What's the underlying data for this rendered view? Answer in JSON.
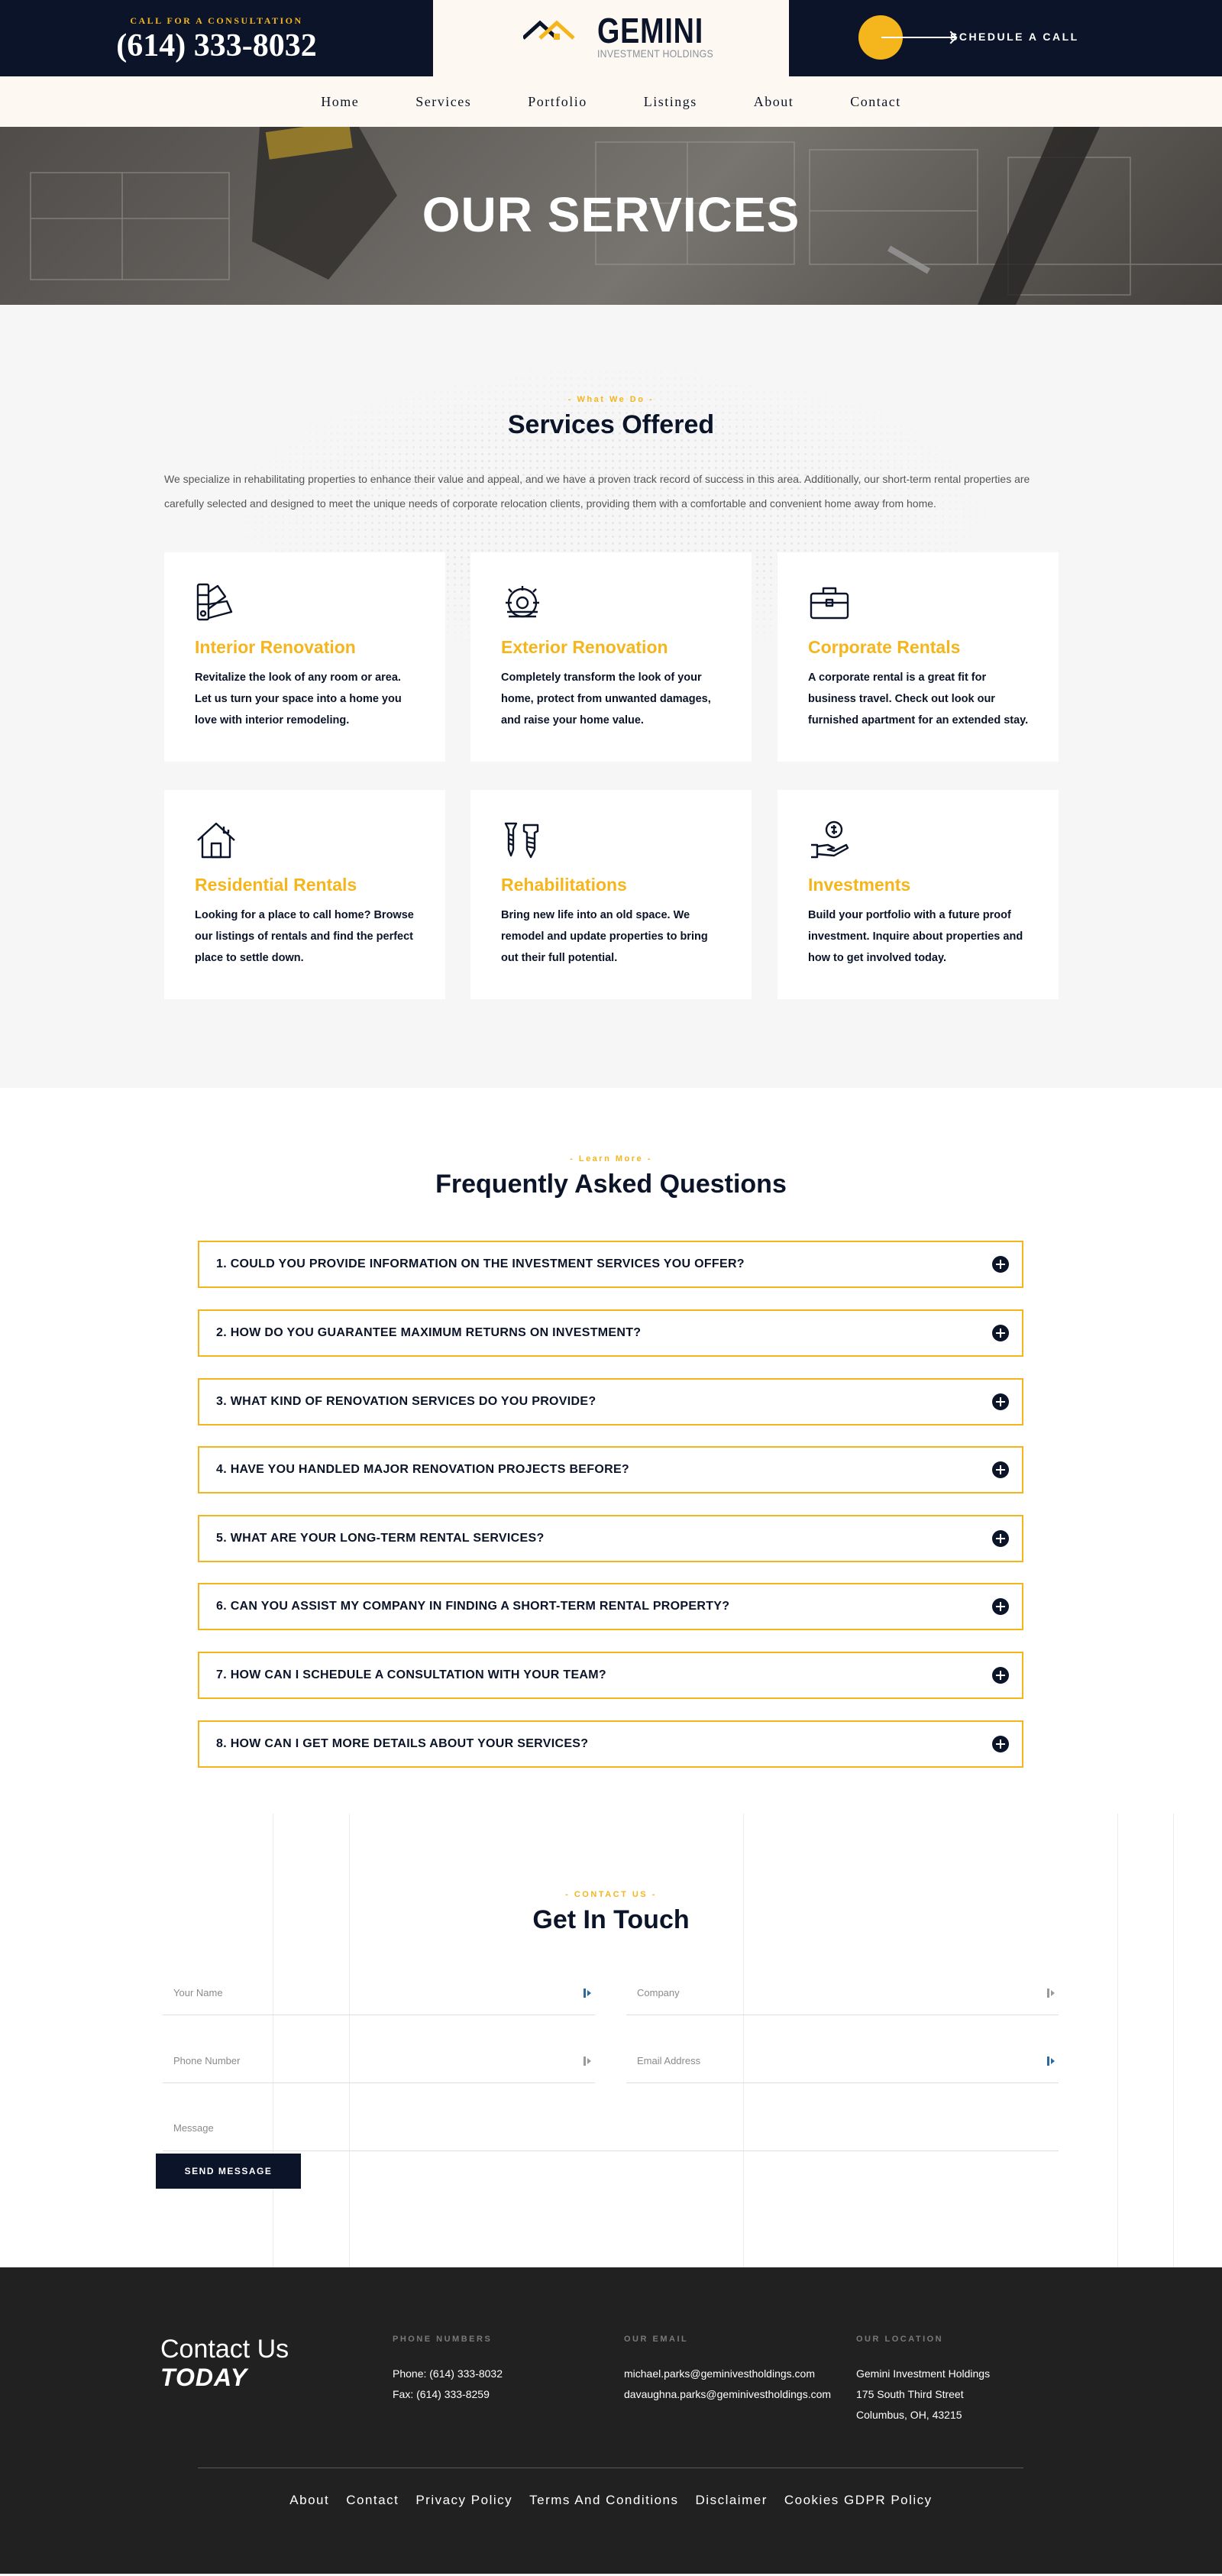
{
  "header": {
    "call_label": "CALL FOR A CONSULTATION",
    "phone": "(614) 333-8032",
    "logo_title": "GEMINI",
    "logo_subtitle": "INVESTMENT HOLDINGS",
    "schedule_label": "SCHEDULE A CALL"
  },
  "nav": {
    "items": [
      "Home",
      "Services",
      "Portfolio",
      "Listings",
      "About",
      "Contact"
    ]
  },
  "hero": {
    "title": "OUR SERVICES"
  },
  "services": {
    "eyebrow": "- What We Do -",
    "title": "Services Offered",
    "intro": "We specialize in rehabilitating properties to enhance their value and appeal, and we have a proven track record of success in this area. Additionally, our short-term rental properties are carefully selected and designed to meet the unique needs of corporate relocation clients, providing them with a comfortable and convenient home away from home.",
    "cards": [
      {
        "icon": "color-swatch-icon",
        "title": "Interior Renovation",
        "text": "Revitalize the look of any room or area. Let us turn your space into a home you love with interior remodeling."
      },
      {
        "icon": "circular-saw-icon",
        "title": "Exterior Renovation",
        "text": "Completely transform the look of your home, protect from unwanted damages, and raise your home value."
      },
      {
        "icon": "briefcase-icon",
        "title": "Corporate Rentals",
        "text": "A corporate rental is a great fit for business travel. Check out look our furnished apartment for an extended stay."
      },
      {
        "icon": "house-icon",
        "title": "Residential Rentals",
        "text": "Looking for a place to call home? Browse our listings of rentals and find the perfect place to settle down."
      },
      {
        "icon": "screw-tools-icon",
        "title": "Rehabilitations",
        "text": "Bring new life into an old space. We remodel and update properties to bring out their full potential."
      },
      {
        "icon": "hand-dollar-icon",
        "title": "Investments",
        "text": "Build your portfolio with a future proof investment. Inquire about properties and how to get involved today."
      }
    ]
  },
  "faq": {
    "eyebrow": "- Learn More -",
    "title": "Frequently Asked Questions",
    "items": [
      "1. COULD YOU PROVIDE INFORMATION ON THE INVESTMENT SERVICES YOU OFFER?",
      "2. HOW DO YOU GUARANTEE MAXIMUM RETURNS ON INVESTMENT?",
      "3. WHAT KIND OF RENOVATION SERVICES DO YOU PROVIDE?",
      "4. HAVE YOU HANDLED MAJOR RENOVATION PROJECTS BEFORE?",
      "5. WHAT ARE YOUR LONG-TERM RENTAL SERVICES?",
      "6. CAN YOU ASSIST MY COMPANY IN FINDING A SHORT-TERM RENTAL PROPERTY?",
      "7. HOW CAN I SCHEDULE A CONSULTATION WITH YOUR TEAM?",
      "8. HOW CAN I GET MORE DETAILS ABOUT YOUR SERVICES?"
    ]
  },
  "contact": {
    "eyebrow": "- CONTACT US -",
    "title": "Get In Touch",
    "fields": {
      "name_placeholder": "Your Name",
      "company_placeholder": "Company",
      "phone_placeholder": "Phone Number",
      "email_placeholder": "Email Address",
      "message_placeholder": "Message"
    },
    "submit_label": "SEND MESSAGE"
  },
  "footer": {
    "title_line1": "Contact Us",
    "title_line2": "TODAY",
    "phones": {
      "heading": "PHONE NUMBERS",
      "lines": [
        "Phone: (614) 333-8032",
        "Fax: (614) 333-8259"
      ]
    },
    "emails": {
      "heading": "OUR EMAIL",
      "lines": [
        "michael.parks@geminivestholdings.com",
        "davaughna.parks@geminivestholdings.com"
      ]
    },
    "location": {
      "heading": "OUR LOCATION",
      "lines": [
        "Gemini Investment Holdings",
        "175 South Third Street",
        "Columbus, OH, 43215"
      ]
    },
    "links": [
      "About",
      "Contact",
      "Privacy Policy",
      "Terms And Conditions",
      "Disclaimer",
      "Cookies GDPR Policy"
    ]
  },
  "colors": {
    "navy": "#0b1428",
    "accent_gold": "#f5b51c",
    "cream": "#fdf9f2",
    "footer_bg": "#212121"
  }
}
